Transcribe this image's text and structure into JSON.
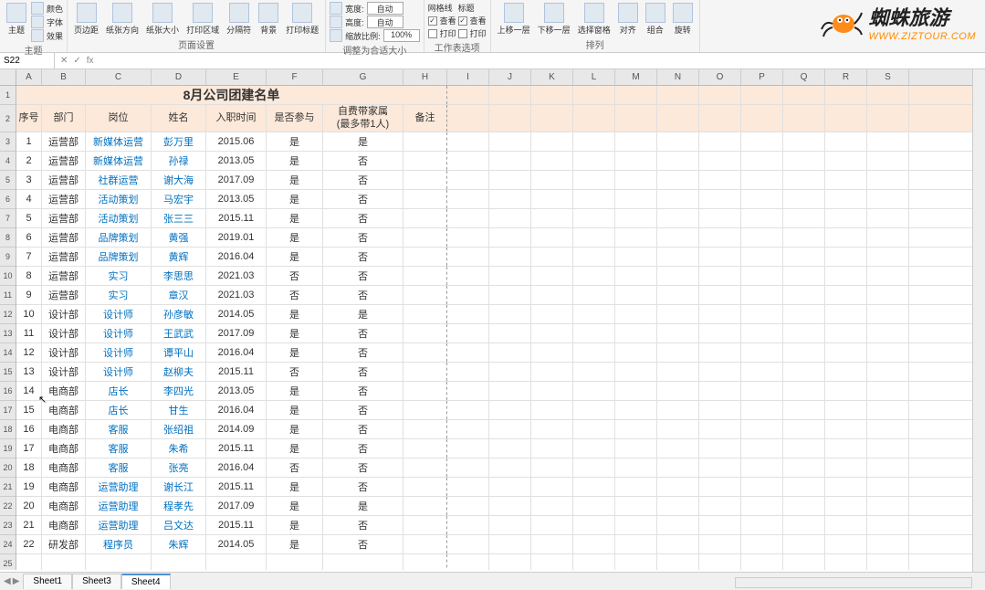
{
  "ribbon": {
    "groups": [
      {
        "label": "主题",
        "items": [
          {
            "label": "主题"
          }
        ],
        "mini": [
          "颜色",
          "字体",
          "效果"
        ]
      },
      {
        "label": "页面设置",
        "items": [
          {
            "label": "页边距"
          },
          {
            "label": "纸张方向"
          },
          {
            "label": "纸张大小"
          },
          {
            "label": "打印区域"
          },
          {
            "label": "分隔符"
          },
          {
            "label": "背景"
          },
          {
            "label": "打印标题"
          }
        ]
      },
      {
        "label": "调整为合适大小",
        "rows": [
          {
            "lbl": "宽度:",
            "val": "自动"
          },
          {
            "lbl": "高度:",
            "val": "自动"
          },
          {
            "lbl": "缩放比例:",
            "val": "100%"
          }
        ]
      },
      {
        "label": "工作表选项",
        "cols": [
          {
            "title": "网格线",
            "chk1": "查看",
            "chk2": "打印",
            "c1": true,
            "c2": false
          },
          {
            "title": "标题",
            "chk1": "查看",
            "chk2": "打印",
            "c1": true,
            "c2": false
          }
        ]
      },
      {
        "label": "排列",
        "items": [
          {
            "label": "上移一层"
          },
          {
            "label": "下移一层"
          },
          {
            "label": "选择窗格"
          },
          {
            "label": "对齐"
          },
          {
            "label": "组合"
          },
          {
            "label": "旋转"
          }
        ]
      }
    ]
  },
  "logo": {
    "cn": "蜘蛛旅游",
    "en": "WWW.ZIZTOUR.COM"
  },
  "nameBox": "S22",
  "columns": [
    "A",
    "B",
    "C",
    "D",
    "E",
    "F",
    "G",
    "H",
    "I",
    "J",
    "K",
    "L",
    "M",
    "N",
    "O",
    "P",
    "Q",
    "R",
    "S"
  ],
  "sheet": {
    "title": "8月公司团建名单",
    "headers": [
      "序号",
      "部门",
      "岗位",
      "姓名",
      "入职时间",
      "是否参与",
      "自费带家属\n(最多带1人)",
      "备注"
    ],
    "rows": [
      [
        "1",
        "运营部",
        "新媒体运营",
        "彭万里",
        "2015.06",
        "是",
        "是",
        ""
      ],
      [
        "2",
        "运营部",
        "新媒体运营",
        "孙禄",
        "2013.05",
        "是",
        "否",
        ""
      ],
      [
        "3",
        "运营部",
        "社群运营",
        "谢大海",
        "2017.09",
        "是",
        "否",
        ""
      ],
      [
        "4",
        "运营部",
        "活动策划",
        "马宏宇",
        "2013.05",
        "是",
        "否",
        ""
      ],
      [
        "5",
        "运营部",
        "活动策划",
        "张三三",
        "2015.11",
        "是",
        "否",
        ""
      ],
      [
        "6",
        "运营部",
        "品牌策划",
        "黄强",
        "2019.01",
        "是",
        "否",
        ""
      ],
      [
        "7",
        "运营部",
        "品牌策划",
        "黄辉",
        "2016.04",
        "是",
        "否",
        ""
      ],
      [
        "8",
        "运营部",
        "实习",
        "李思思",
        "2021.03",
        "否",
        "否",
        ""
      ],
      [
        "9",
        "运营部",
        "实习",
        "章汉",
        "2021.03",
        "否",
        "否",
        ""
      ],
      [
        "10",
        "设计部",
        "设计师",
        "孙彦敏",
        "2014.05",
        "是",
        "是",
        ""
      ],
      [
        "11",
        "设计部",
        "设计师",
        "王武武",
        "2017.09",
        "是",
        "否",
        ""
      ],
      [
        "12",
        "设计部",
        "设计师",
        "谭平山",
        "2016.04",
        "是",
        "否",
        ""
      ],
      [
        "13",
        "设计部",
        "设计师",
        "赵柳夫",
        "2015.11",
        "否",
        "否",
        ""
      ],
      [
        "14",
        "电商部",
        "店长",
        "李四光",
        "2013.05",
        "是",
        "否",
        ""
      ],
      [
        "15",
        "电商部",
        "店长",
        "甘生",
        "2016.04",
        "是",
        "否",
        ""
      ],
      [
        "16",
        "电商部",
        "客服",
        "张绍祖",
        "2014.09",
        "是",
        "否",
        ""
      ],
      [
        "17",
        "电商部",
        "客服",
        "朱希",
        "2015.11",
        "是",
        "否",
        ""
      ],
      [
        "18",
        "电商部",
        "客服",
        "张亮",
        "2016.04",
        "否",
        "否",
        ""
      ],
      [
        "19",
        "电商部",
        "运营助理",
        "谢长江",
        "2015.11",
        "是",
        "否",
        ""
      ],
      [
        "20",
        "电商部",
        "运营助理",
        "程孝先",
        "2017.09",
        "是",
        "是",
        ""
      ],
      [
        "21",
        "电商部",
        "运营助理",
        "吕文达",
        "2015.11",
        "是",
        "否",
        ""
      ],
      [
        "22",
        "研发部",
        "程序员",
        "朱辉",
        "2014.05",
        "是",
        "否",
        ""
      ]
    ]
  },
  "tabs": [
    "Sheet1",
    "Sheet3",
    "Sheet4"
  ],
  "activeTab": "Sheet4",
  "chart_data": {
    "type": "table",
    "title": "8月公司团建名单",
    "columns": [
      "序号",
      "部门",
      "岗位",
      "姓名",
      "入职时间",
      "是否参与",
      "自费带家属(最多带1人)",
      "备注"
    ],
    "rows": [
      [
        1,
        "运营部",
        "新媒体运营",
        "彭万里",
        "2015.06",
        "是",
        "是",
        ""
      ],
      [
        2,
        "运营部",
        "新媒体运营",
        "孙禄",
        "2013.05",
        "是",
        "否",
        ""
      ],
      [
        3,
        "运营部",
        "社群运营",
        "谢大海",
        "2017.09",
        "是",
        "否",
        ""
      ],
      [
        4,
        "运营部",
        "活动策划",
        "马宏宇",
        "2013.05",
        "是",
        "否",
        ""
      ],
      [
        5,
        "运营部",
        "活动策划",
        "张三三",
        "2015.11",
        "是",
        "否",
        ""
      ],
      [
        6,
        "运营部",
        "品牌策划",
        "黄强",
        "2019.01",
        "是",
        "否",
        ""
      ],
      [
        7,
        "运营部",
        "品牌策划",
        "黄辉",
        "2016.04",
        "是",
        "否",
        ""
      ],
      [
        8,
        "运营部",
        "实习",
        "李思思",
        "2021.03",
        "否",
        "否",
        ""
      ],
      [
        9,
        "运营部",
        "实习",
        "章汉",
        "2021.03",
        "否",
        "否",
        ""
      ],
      [
        10,
        "设计部",
        "设计师",
        "孙彦敏",
        "2014.05",
        "是",
        "是",
        ""
      ],
      [
        11,
        "设计部",
        "设计师",
        "王武武",
        "2017.09",
        "是",
        "否",
        ""
      ],
      [
        12,
        "设计部",
        "设计师",
        "谭平山",
        "2016.04",
        "是",
        "否",
        ""
      ],
      [
        13,
        "设计部",
        "设计师",
        "赵柳夫",
        "2015.11",
        "否",
        "否",
        ""
      ],
      [
        14,
        "电商部",
        "店长",
        "李四光",
        "2013.05",
        "是",
        "否",
        ""
      ],
      [
        15,
        "电商部",
        "店长",
        "甘生",
        "2016.04",
        "是",
        "否",
        ""
      ],
      [
        16,
        "电商部",
        "客服",
        "张绍祖",
        "2014.09",
        "是",
        "否",
        ""
      ],
      [
        17,
        "电商部",
        "客服",
        "朱希",
        "2015.11",
        "是",
        "否",
        ""
      ],
      [
        18,
        "电商部",
        "客服",
        "张亮",
        "2016.04",
        "否",
        "否",
        ""
      ],
      [
        19,
        "电商部",
        "运营助理",
        "谢长江",
        "2015.11",
        "是",
        "否",
        ""
      ],
      [
        20,
        "电商部",
        "运营助理",
        "程孝先",
        "2017.09",
        "是",
        "是",
        ""
      ],
      [
        21,
        "电商部",
        "运营助理",
        "吕文达",
        "2015.11",
        "是",
        "否",
        ""
      ],
      [
        22,
        "研发部",
        "程序员",
        "朱辉",
        "2014.05",
        "是",
        "否",
        ""
      ]
    ]
  }
}
